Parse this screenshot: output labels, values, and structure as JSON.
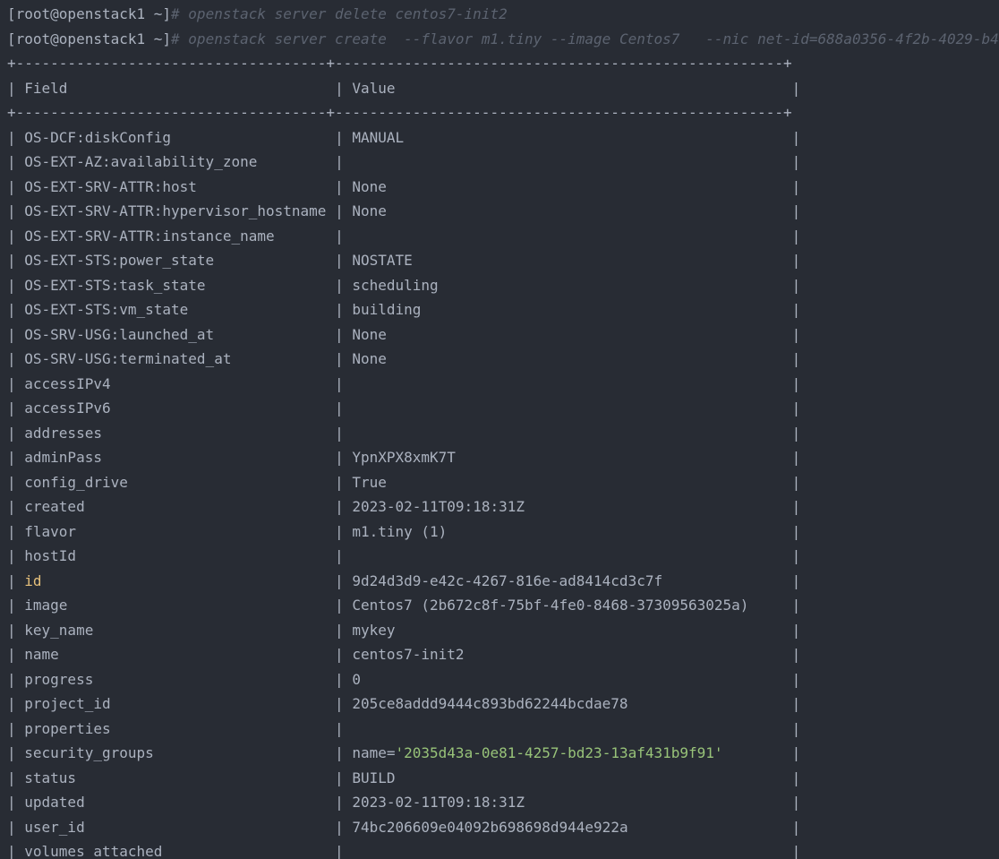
{
  "terminal": {
    "prompt": "[root@openstack1 ~]",
    "commands": [
      "# openstack server delete centos7-init2",
      "# openstack server create  --flavor m1.tiny --image Centos7   --nic net-id=688a0356-4f2b-4029-b4"
    ],
    "border": "+------------------------------------+----------------------------------------------------+",
    "header": {
      "field": "Field",
      "value": "Value"
    },
    "rows": [
      {
        "field": "OS-DCF:diskConfig",
        "value": "MANUAL"
      },
      {
        "field": "OS-EXT-AZ:availability_zone",
        "value": ""
      },
      {
        "field": "OS-EXT-SRV-ATTR:host",
        "value": "None"
      },
      {
        "field": "OS-EXT-SRV-ATTR:hypervisor_hostname",
        "value": "None"
      },
      {
        "field": "OS-EXT-SRV-ATTR:instance_name",
        "value": ""
      },
      {
        "field": "OS-EXT-STS:power_state",
        "value": "NOSTATE"
      },
      {
        "field": "OS-EXT-STS:task_state",
        "value": "scheduling"
      },
      {
        "field": "OS-EXT-STS:vm_state",
        "value": "building"
      },
      {
        "field": "OS-SRV-USG:launched_at",
        "value": "None"
      },
      {
        "field": "OS-SRV-USG:terminated_at",
        "value": "None"
      },
      {
        "field": "accessIPv4",
        "value": ""
      },
      {
        "field": "accessIPv6",
        "value": ""
      },
      {
        "field": "addresses",
        "value": ""
      },
      {
        "field": "adminPass",
        "value": "YpnXPX8xmK7T"
      },
      {
        "field": "config_drive",
        "value": "True"
      },
      {
        "field": "created",
        "value": "2023-02-11T09:18:31Z"
      },
      {
        "field": "flavor",
        "value": "m1.tiny (1)"
      },
      {
        "field": "hostId",
        "value": ""
      },
      {
        "field": "id",
        "value": "9d24d3d9-e42c-4267-816e-ad8414cd3c7f",
        "highlight": true
      },
      {
        "field": "image",
        "value": "Centos7 (2b672c8f-75bf-4fe0-8468-37309563025a)"
      },
      {
        "field": "key_name",
        "value": "mykey"
      },
      {
        "field": "name",
        "value": "centos7-init2"
      },
      {
        "field": "progress",
        "value": "0"
      },
      {
        "field": "project_id",
        "value": "205ce8addd9444c893bd62244bcdae78"
      },
      {
        "field": "properties",
        "value": ""
      },
      {
        "field": "security_groups",
        "value": "name='2035d43a-0e81-4257-bd23-13af431b9f91'",
        "value_prefix": "name=",
        "value_string": "'2035d43a-0e81-4257-bd23-13af431b9f91'"
      },
      {
        "field": "status",
        "value": "BUILD"
      },
      {
        "field": "updated",
        "value": "2023-02-11T09:18:31Z"
      },
      {
        "field": "user_id",
        "value": "74bc206609e04092b698698d944e922a"
      },
      {
        "field": "volumes_attached",
        "value": ""
      }
    ],
    "colors": {
      "background": "#282c34",
      "text": "#abb2bf",
      "comment": "#5c6370",
      "highlight_key": "#e5c07b",
      "string": "#98c379"
    }
  }
}
